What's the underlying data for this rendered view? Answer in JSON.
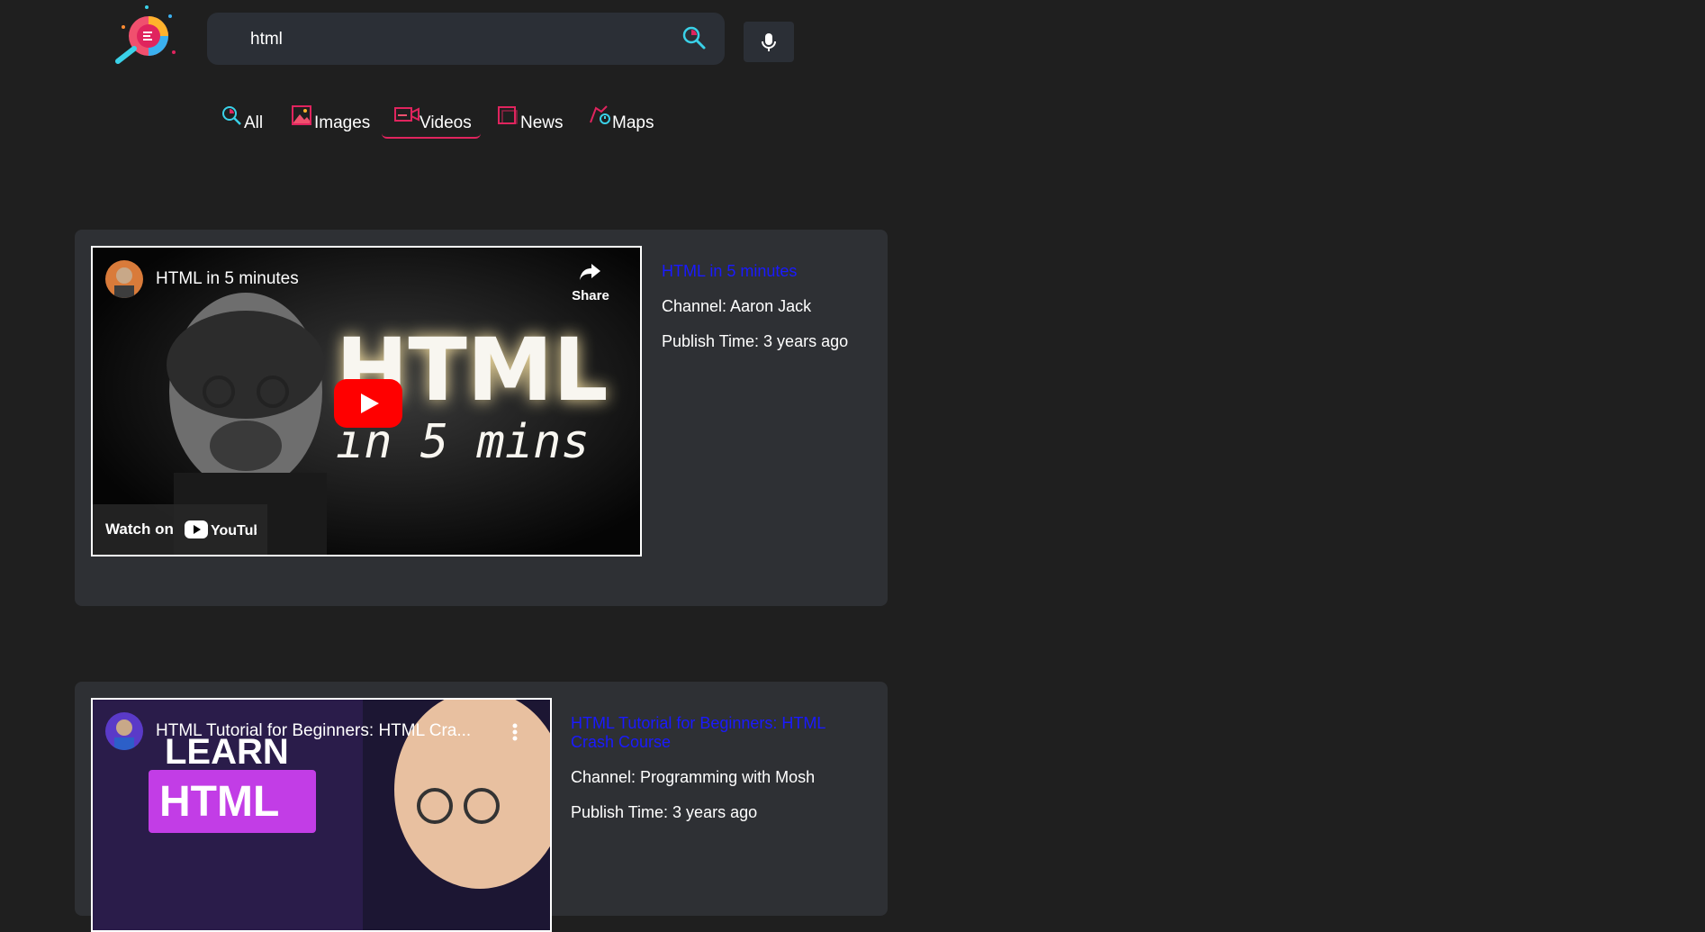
{
  "search": {
    "value": "html"
  },
  "tabs": [
    {
      "label": "All",
      "icon": "search-icon"
    },
    {
      "label": "Images",
      "icon": "image-icon"
    },
    {
      "label": "Videos",
      "icon": "video-camera-icon",
      "active": true
    },
    {
      "label": "News",
      "icon": "news-icon"
    },
    {
      "label": "Maps",
      "icon": "map-icon"
    }
  ],
  "results": [
    {
      "embed_title": "HTML in 5 minutes",
      "title": "HTML in 5 minutes",
      "channel": "Channel: Aaron Jack",
      "publish": "Publish Time: 3 years ago",
      "share_label": "Share",
      "watch_label": "Watch on",
      "thumb_big": "HTML",
      "thumb_small": "in 5 mins"
    },
    {
      "embed_title": "HTML Tutorial for Beginners: HTML Cra...",
      "title": "HTML Tutorial for Beginners: HTML Crash Course",
      "channel": "Channel: Programming with Mosh",
      "publish": "Publish Time: 3 years ago",
      "thumb_learn": "LEARN",
      "thumb_html": "HTML"
    }
  ],
  "colors": {
    "accent": "#e0245e",
    "link": "#1a1aff",
    "card": "#2e3034",
    "background": "#1f1f1f"
  }
}
